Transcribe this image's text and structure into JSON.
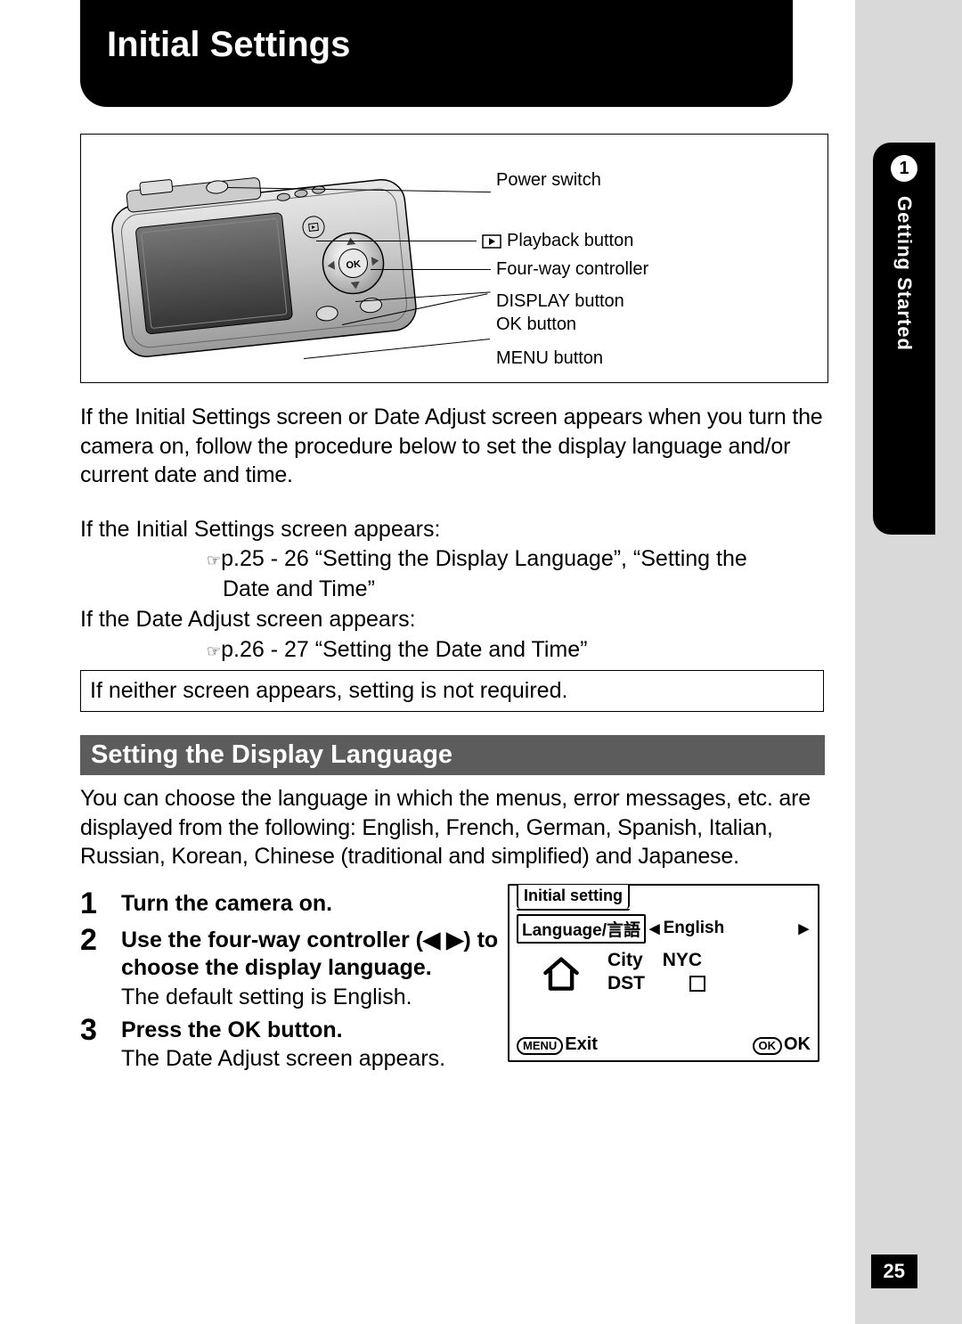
{
  "title": "Initial Settings",
  "chapter": {
    "number": "1",
    "label": "Getting Started"
  },
  "diagram_labels": {
    "power": "Power switch",
    "playback": "Playback button",
    "fourway": "Four-way controller",
    "display": "DISPLAY button",
    "ok": "OK button",
    "menu": "MENU button"
  },
  "intro": "If the Initial Settings screen or Date Adjust screen appears when you turn the camera on, follow the procedure below to set the display language and/or current date and time.",
  "refs": {
    "if1": "If the Initial Settings screen appears:",
    "ptr": "☞",
    "ref1": "p.25 - 26 “Setting the Display Language”, “Setting the Date and Time”",
    "if2": "If the Date Adjust screen appears:",
    "ref2": "p.26 - 27 “Setting the Date and Time”"
  },
  "note": "If neither screen appears, setting is not required.",
  "section": {
    "title": "Setting the Display Language",
    "intro": "You can choose the language in which the menus, error messages, etc. are displayed from the following: English, French, German, Spanish, Italian, Russian, Korean, Chinese (traditional and simplified) and Japanese."
  },
  "steps": [
    {
      "n": "1",
      "head": "Turn the camera on.",
      "desc": ""
    },
    {
      "n": "2",
      "head": "Use the four-way controller (◀ ▶) to choose the display language.",
      "desc": "The default setting is English."
    },
    {
      "n": "3",
      "head": "Press the OK button.",
      "desc": "The Date Adjust screen appears."
    }
  ],
  "lcd": {
    "tab": "Initial setting",
    "lang_label": "Language/言語",
    "lang_value": "English",
    "city_label": "City",
    "city_value": "NYC",
    "dst_label": "DST",
    "menu_btn": "MENU",
    "exit": "Exit",
    "ok_btn": "OK",
    "ok": "OK"
  },
  "page_number": "25"
}
